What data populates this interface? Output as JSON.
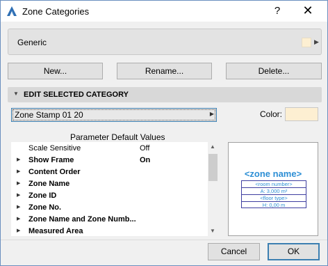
{
  "window": {
    "title": "Zone Categories",
    "help_label": "?",
    "close_label": "✕"
  },
  "category": {
    "name": "Generic",
    "color": "#fdefd2"
  },
  "buttons": {
    "new": "New...",
    "rename": "Rename...",
    "delete": "Delete..."
  },
  "section": {
    "title": "EDIT SELECTED CATEGORY"
  },
  "stamp": {
    "selected": "Zone Stamp 01 20"
  },
  "color": {
    "label": "Color:",
    "value": "#fdefd2"
  },
  "parameters": {
    "title": "Parameter Default Values",
    "rows": [
      {
        "name": "Scale Sensitive",
        "value": "Off",
        "expandable": false,
        "bold": false
      },
      {
        "name": "Show Frame",
        "value": "On",
        "expandable": true,
        "bold": true
      },
      {
        "name": "Content Order",
        "value": "",
        "expandable": true,
        "bold": true
      },
      {
        "name": "Zone Name",
        "value": "",
        "expandable": true,
        "bold": true
      },
      {
        "name": "Zone ID",
        "value": "",
        "expandable": true,
        "bold": true
      },
      {
        "name": "Zone No.",
        "value": "",
        "expandable": true,
        "bold": true
      },
      {
        "name": "Zone Name and Zone Numb...",
        "value": "",
        "expandable": true,
        "bold": true
      },
      {
        "name": "Measured Area",
        "value": "",
        "expandable": true,
        "bold": true
      }
    ]
  },
  "preview": {
    "title": "<zone name>",
    "lines": [
      "<room number>",
      "A: 3,000 m²",
      "<floor type>",
      "H: 0,00 m"
    ]
  },
  "footer": {
    "cancel": "Cancel",
    "ok": "OK"
  },
  "colors": {
    "accent": "#3c7fb1",
    "stamp_text": "#2d8fd5",
    "stamp_border": "#3d3d9f"
  }
}
